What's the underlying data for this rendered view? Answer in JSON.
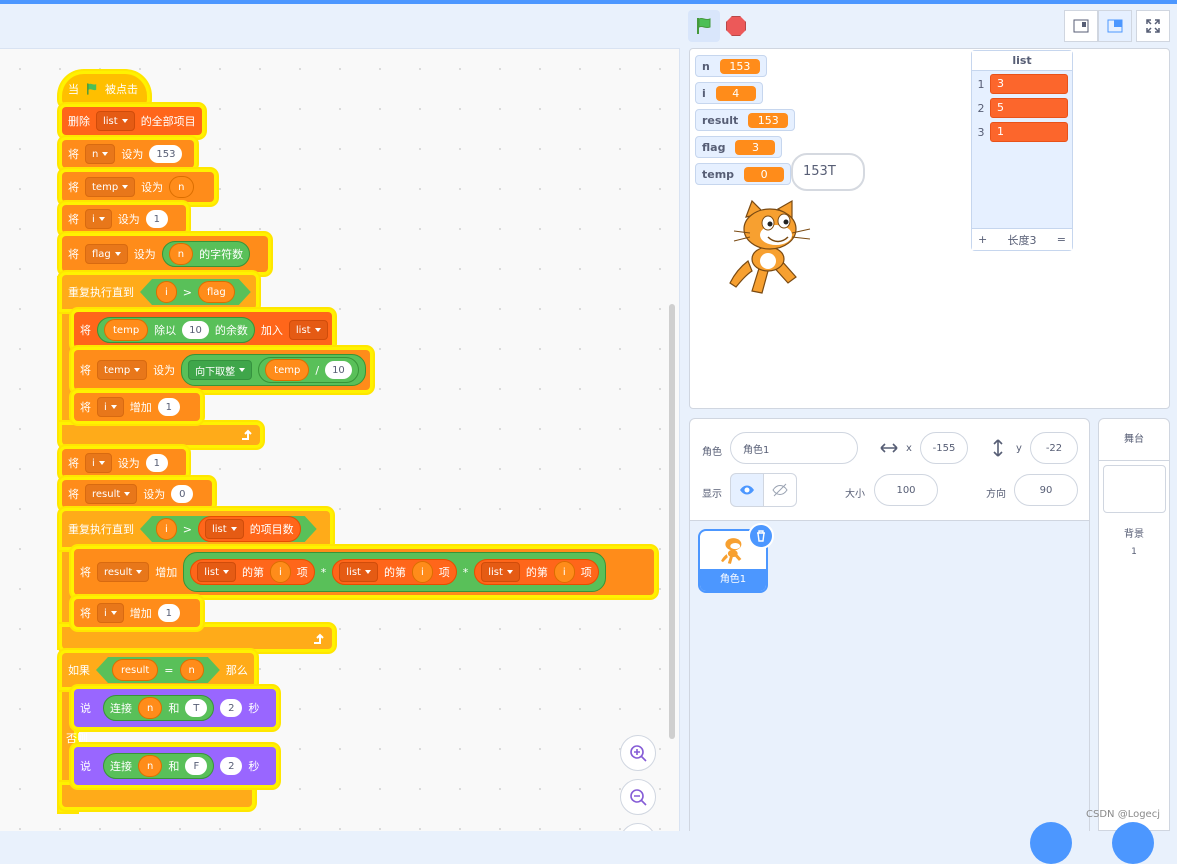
{
  "header": {
    "flag_icon": "green-flag",
    "stop_icon": "stop-sign"
  },
  "stage": {
    "monitors": [
      {
        "name": "n",
        "value": "153"
      },
      {
        "name": "i",
        "value": "4"
      },
      {
        "name": "result",
        "value": "153"
      },
      {
        "name": "flag",
        "value": "3"
      },
      {
        "name": "temp",
        "value": "0"
      }
    ],
    "list": {
      "title": "list",
      "items": [
        {
          "index": "1",
          "value": "3"
        },
        {
          "index": "2",
          "value": "5"
        },
        {
          "index": "3",
          "value": "1"
        }
      ],
      "add": "+",
      "length": "长度3",
      "eq": "="
    },
    "speech_bubble": "153T"
  },
  "sprite_info": {
    "sprite_label": "角色",
    "sprite_name": "角色1",
    "x_label": "x",
    "x_value": "-155",
    "y_label": "y",
    "y_value": "-22",
    "show_label": "显示",
    "size_label": "大小",
    "size_value": "100",
    "direction_label": "方向",
    "direction_value": "90"
  },
  "sprite_tile": {
    "name": "角色1"
  },
  "stage_target": {
    "title": "舞台",
    "backdrop_label": "背景",
    "backdrop_count": "1"
  },
  "watermark": "CSDN @Logecj",
  "code": {
    "when": "当",
    "clicked": "被点击",
    "del": "删除",
    "all_items": "的全部项目",
    "set": "将",
    "to": "设为",
    "add_to": "加入",
    "change": "增加",
    "by": "增加",
    "list": "list",
    "n": "n",
    "temp": "temp",
    "i": "i",
    "flag": "flag",
    "result": "result",
    "v153": "153",
    "v1": "1",
    "v10": "10",
    "v0": "0",
    "v2": "2",
    "length_of": "的字符数",
    "repeat_until": "重复执行直到",
    "gt": ">",
    "eq": "=",
    "divide": "/",
    "mul": "*",
    "mod": "除以",
    "remainder": "的余数",
    "floor": "向下取整",
    "item_count": "的项目数",
    "item_of_a": "的第",
    "item_of_b": "项",
    "if": "如果",
    "then": "那么",
    "else": "否则",
    "say": "说",
    "join": "连接",
    "and": "和",
    "T": "T",
    "F": "F",
    "sec": "秒"
  }
}
